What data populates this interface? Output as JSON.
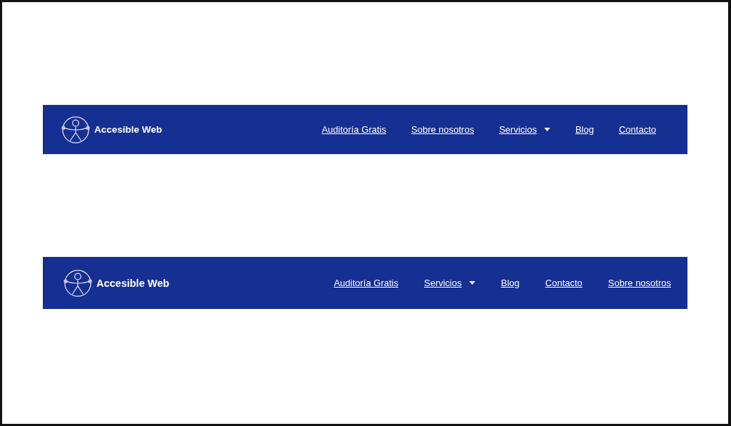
{
  "navbars": [
    {
      "brand": "Accesible Web",
      "links": [
        {
          "label": "Auditoría Gratis",
          "dropdown": false
        },
        {
          "label": "Sobre nosotros",
          "dropdown": false
        },
        {
          "label": "Servicios",
          "dropdown": true
        },
        {
          "label": "Blog",
          "dropdown": false
        },
        {
          "label": "Contacto",
          "dropdown": false
        }
      ]
    },
    {
      "brand": "Accesible Web",
      "links": [
        {
          "label": "Auditoría Gratis",
          "dropdown": false
        },
        {
          "label": "Servicios",
          "dropdown": true
        },
        {
          "label": "Blog",
          "dropdown": false
        },
        {
          "label": "Contacto",
          "dropdown": false
        },
        {
          "label": "Sobre nosotros",
          "dropdown": false
        }
      ]
    }
  ]
}
